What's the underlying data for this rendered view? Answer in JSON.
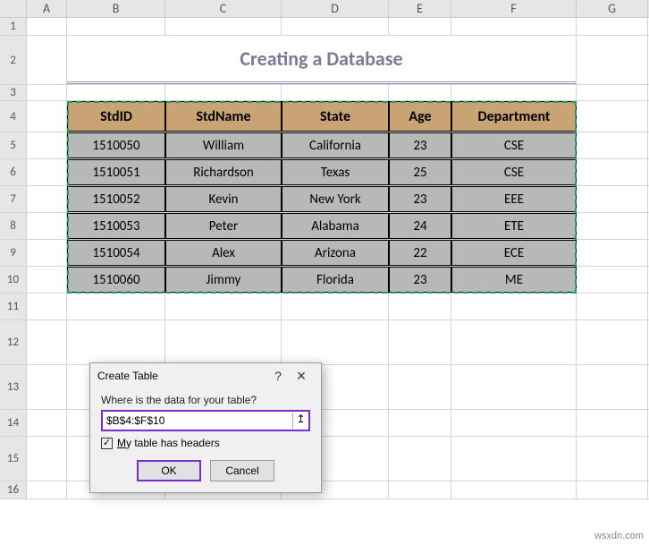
{
  "columns": [
    "A",
    "B",
    "C",
    "D",
    "E",
    "F",
    "G"
  ],
  "rows": [
    "1",
    "2",
    "3",
    "4",
    "5",
    "6",
    "7",
    "8",
    "9",
    "10",
    "11",
    "12",
    "13",
    "14",
    "15",
    "16"
  ],
  "title": "Creating a Database",
  "table": {
    "headers": [
      "StdID",
      "StdName",
      "State",
      "Age",
      "Department"
    ],
    "data": [
      [
        "1510050",
        "William",
        "California",
        "23",
        "CSE"
      ],
      [
        "1510051",
        "Richardson",
        "Texas",
        "25",
        "CSE"
      ],
      [
        "1510052",
        "Kevin",
        "New York",
        "23",
        "EEE"
      ],
      [
        "1510053",
        "Peter",
        "Alabama",
        "24",
        "ETE"
      ],
      [
        "1510054",
        "Alex",
        "Arizona",
        "22",
        "ECE"
      ],
      [
        "1510060",
        "Jimmy",
        "Florida",
        "23",
        "ME"
      ]
    ]
  },
  "dialog": {
    "title": "Create Table",
    "help": "?",
    "close": "×",
    "question": "Where is the data for your table?",
    "range_value": "$B$4:$F$10",
    "ref_icon": "↥",
    "checkbox_checked": true,
    "checkbox_mark": "✓",
    "checkbox_prefix": "M",
    "checkbox_rest": "y table has headers",
    "ok": "OK",
    "cancel": "Cancel"
  },
  "watermark": "wsxdn.com"
}
